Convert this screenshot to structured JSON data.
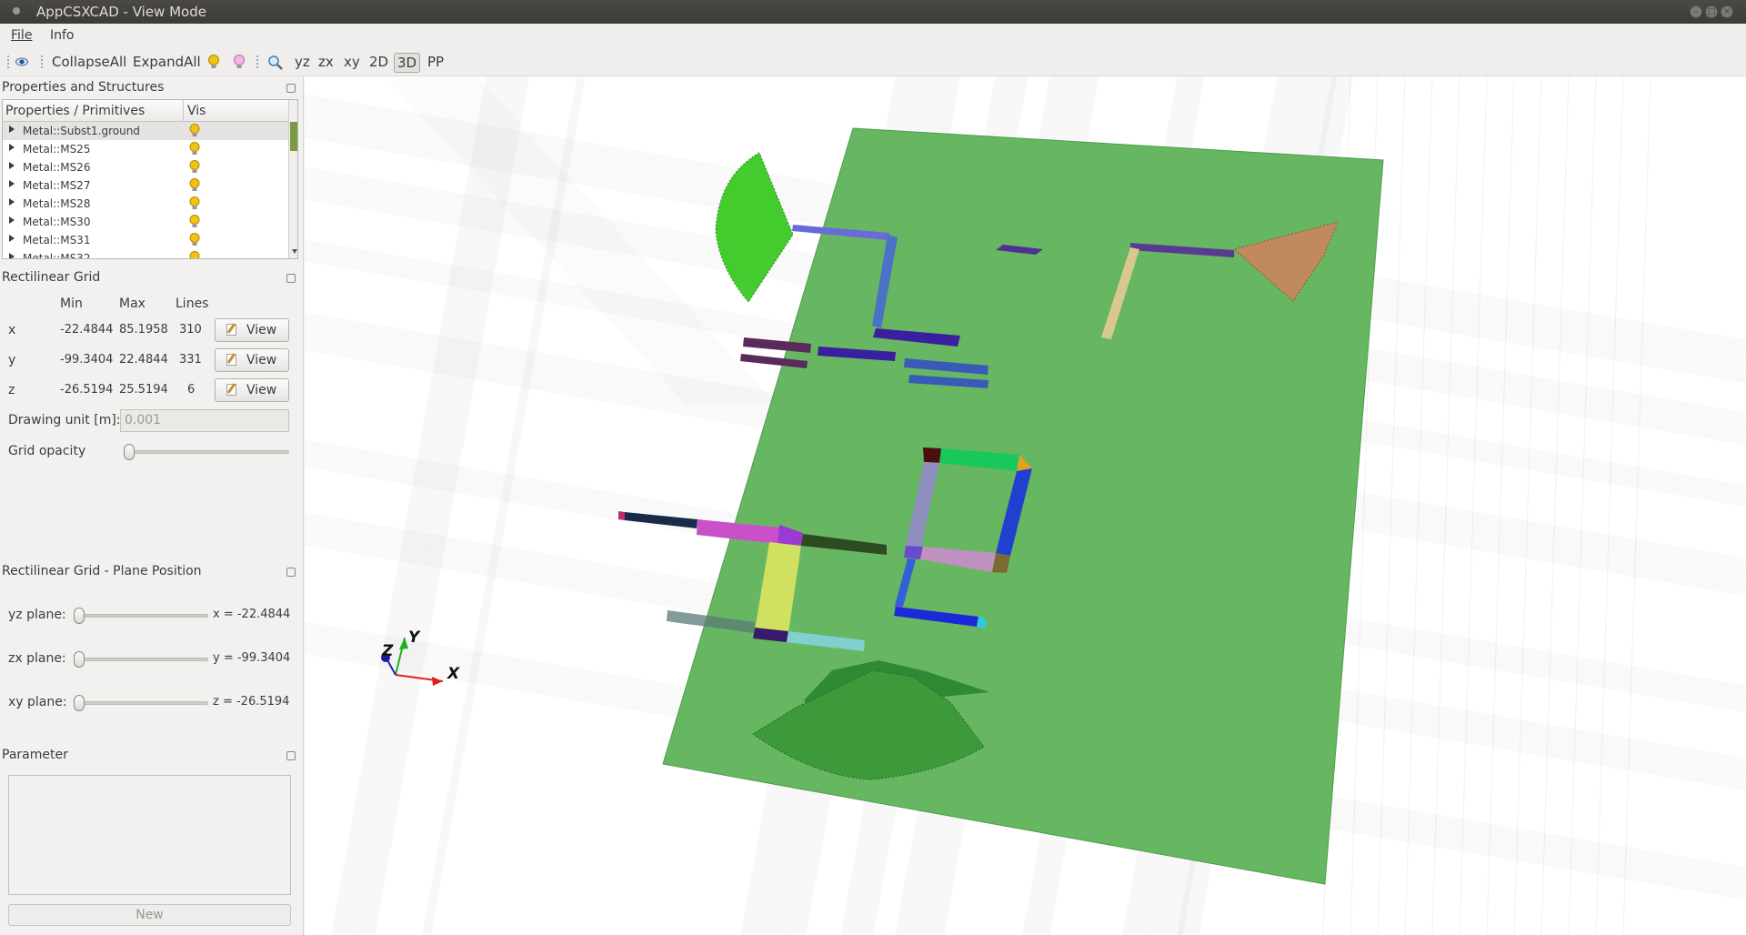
{
  "window": {
    "title": "AppCSXCAD - View Mode"
  },
  "menu": {
    "file": "File",
    "info": "Info"
  },
  "toolbar": {
    "collapse_all": "CollapseAll",
    "expand_all": "ExpandAll",
    "yz": "yz",
    "zx": "zx",
    "xy": "xy",
    "2d": "2D",
    "3d": "3D",
    "pp": "PP"
  },
  "properties": {
    "title": "Properties and Structures",
    "col_name": "Properties / Primitives",
    "col_vis": "Vis",
    "items": [
      {
        "label": "Metal::Subst1.ground"
      },
      {
        "label": "Metal::MS25"
      },
      {
        "label": "Metal::MS26"
      },
      {
        "label": "Metal::MS27"
      },
      {
        "label": "Metal::MS28"
      },
      {
        "label": "Metal::MS30"
      },
      {
        "label": "Metal::MS31"
      },
      {
        "label": "Metal::MS32"
      }
    ]
  },
  "grid": {
    "title": "Rectilinear Grid",
    "col_min": "Min",
    "col_max": "Max",
    "col_lines": "Lines",
    "view_label": "View",
    "rows": [
      {
        "axis": "x",
        "min": "-22.4844",
        "max": "85.1958",
        "lines": "310"
      },
      {
        "axis": "y",
        "min": "-99.3404",
        "max": "22.4844",
        "lines": "331"
      },
      {
        "axis": "z",
        "min": "-26.5194",
        "max": "25.5194",
        "lines": "6"
      }
    ],
    "unit_label": "Drawing unit [m]:",
    "unit_value": "0.001",
    "opacity_label": "Grid opacity"
  },
  "plane": {
    "title": "Rectilinear Grid - Plane Position",
    "yz_label": "yz plane:",
    "yz_value": "x = -22.4844",
    "zx_label": "zx plane:",
    "zx_value": "y = -99.3404",
    "xy_label": "xy plane:",
    "xy_value": "z = -26.5194"
  },
  "parameter": {
    "title": "Parameter",
    "new_label": "New"
  },
  "axes": {
    "x": "X",
    "y": "Y",
    "z": "Z"
  },
  "colors": {
    "substrate": "#5fb35a",
    "bulb": "#f2c40f"
  }
}
